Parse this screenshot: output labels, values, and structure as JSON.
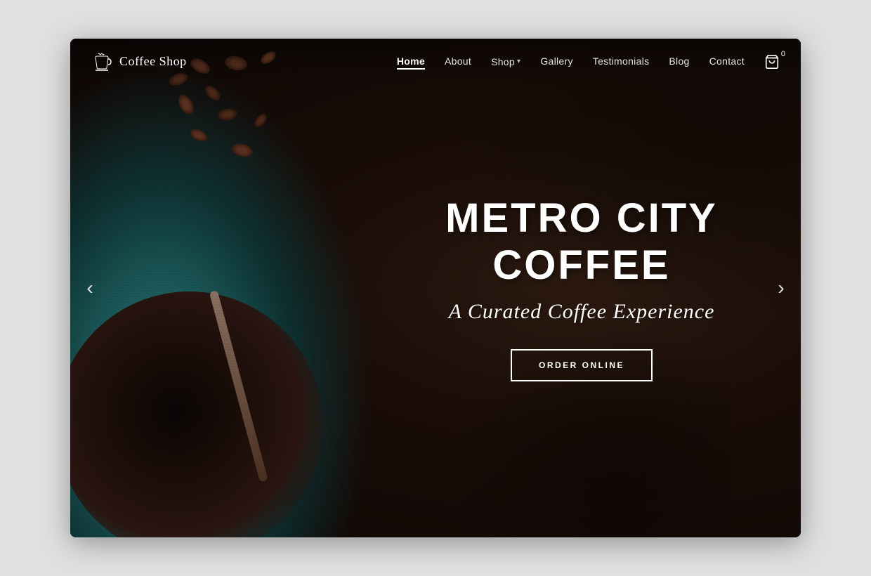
{
  "window": {
    "title": "Coffee Shop"
  },
  "logo": {
    "text": "Coffee Shop",
    "icon_name": "coffee-cup-icon"
  },
  "navbar": {
    "links": [
      {
        "label": "Home",
        "active": true,
        "has_dropdown": false
      },
      {
        "label": "About",
        "active": false,
        "has_dropdown": false
      },
      {
        "label": "Shop",
        "active": false,
        "has_dropdown": true
      },
      {
        "label": "Gallery",
        "active": false,
        "has_dropdown": false
      },
      {
        "label": "Testimonials",
        "active": false,
        "has_dropdown": false
      },
      {
        "label": "Blog",
        "active": false,
        "has_dropdown": false
      },
      {
        "label": "Contact",
        "active": false,
        "has_dropdown": false
      }
    ],
    "cart": {
      "count": "0",
      "icon_name": "cart-icon"
    }
  },
  "hero": {
    "title": "METRO CITY COFFEE",
    "subtitle": "A Curated Coffee Experience",
    "cta_label": "ORDER ONLINE"
  },
  "carousel": {
    "prev_label": "‹",
    "next_label": "›"
  }
}
